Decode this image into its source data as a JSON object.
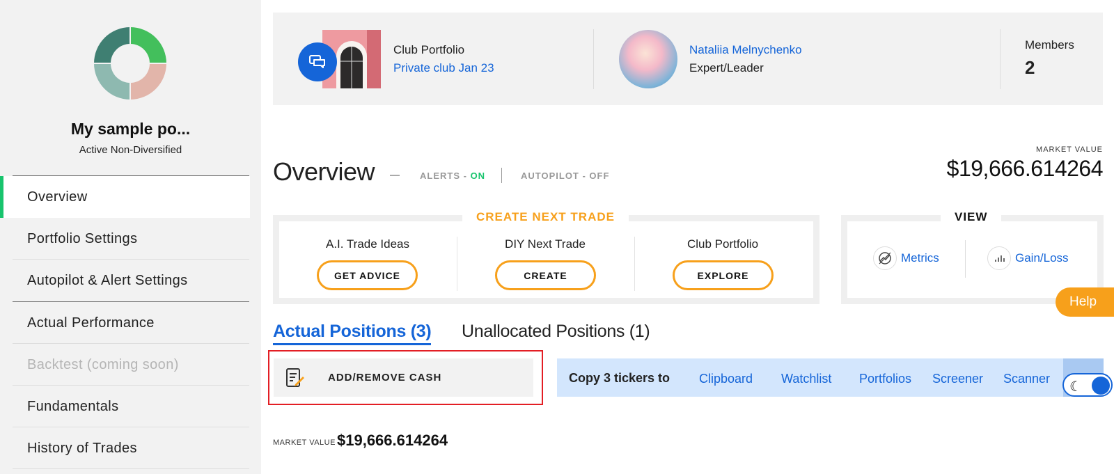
{
  "sidebar": {
    "portfolio_name": "My sample po...",
    "portfolio_type": "Active Non-Diversified",
    "donut_colors": [
      "#3f7f72",
      "#43bf5c",
      "#e2b5aa",
      "#8eb9b0"
    ],
    "items": [
      {
        "label": "Overview",
        "active": true
      },
      {
        "label": "Portfolio Settings"
      },
      {
        "label": "Autopilot & Alert Settings"
      },
      {
        "label": "Actual Performance"
      },
      {
        "label": "Backtest (coming soon)",
        "disabled": true
      },
      {
        "label": "Fundamentals"
      },
      {
        "label": "History of Trades"
      }
    ]
  },
  "club": {
    "label": "Club Portfolio",
    "link": "Private club Jan 23",
    "leader_name": "Nataliia Melnychenko",
    "leader_role": "Expert/Leader",
    "members_label": "Members",
    "members_count": "2"
  },
  "overview": {
    "title": "Overview",
    "alerts_prefix": "ALERTS - ",
    "alerts_state": "ON",
    "autopilot": "AUTOPILOT - OFF",
    "market_value_label": "MARKET VALUE",
    "market_value": "$19,666.614264"
  },
  "trade": {
    "title": "CREATE NEXT TRADE",
    "columns": [
      {
        "label": "A.I. Trade Ideas",
        "button": "GET ADVICE"
      },
      {
        "label": "DIY Next Trade",
        "button": "CREATE"
      },
      {
        "label": "Club Portfolio",
        "button": "EXPLORE"
      }
    ]
  },
  "view": {
    "title": "VIEW",
    "metrics": "Metrics",
    "gainloss": "Gain/Loss"
  },
  "help": "Help",
  "tabs": {
    "actual": "Actual Positions (3)",
    "unallocated": "Unallocated Positions (1)"
  },
  "cash_button": "ADD/REMOVE CASH",
  "copy": {
    "text": "Copy 3 tickers to",
    "links": [
      "Clipboard",
      "Watchlist",
      "Portfolios",
      "Screener",
      "Scanner"
    ]
  },
  "bottom": {
    "market_value_label": "MARKET VALUE",
    "market_value": "$19,666.614264"
  },
  "colors": {
    "accent_blue": "#1565d8",
    "accent_orange": "#f7a01b",
    "active_green": "#18c46d",
    "highlight_red": "#e31e24"
  }
}
